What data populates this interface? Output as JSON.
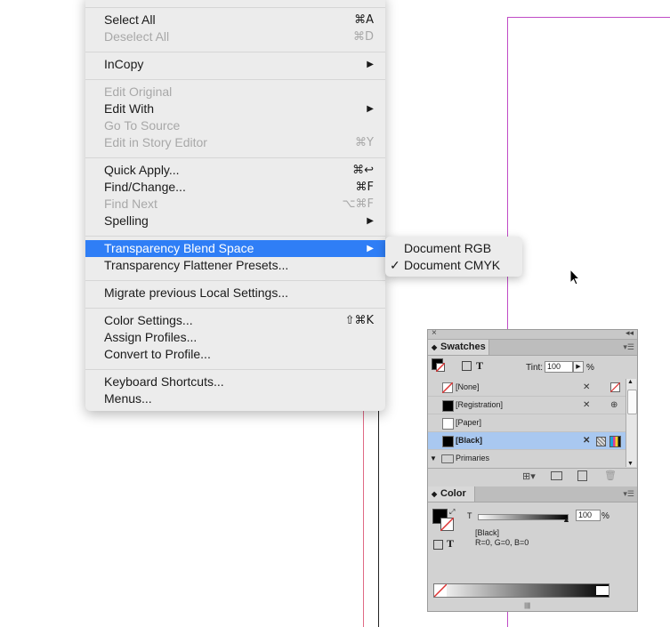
{
  "menu": {
    "items": [
      {
        "label": "Select All",
        "shortcut": "⌘A",
        "disabled": false
      },
      {
        "label": "Deselect All",
        "shortcut": "⌘D",
        "disabled": true
      },
      {
        "label": "InCopy",
        "submenu": true,
        "disabled": false
      },
      {
        "label": "Edit Original",
        "disabled": true
      },
      {
        "label": "Edit With",
        "submenu": true,
        "disabled": false
      },
      {
        "label": "Go To Source",
        "disabled": true
      },
      {
        "label": "Edit in Story Editor",
        "shortcut": "⌘Y",
        "disabled": true
      },
      {
        "label": "Quick Apply...",
        "shortcut": "⌘↩",
        "disabled": false
      },
      {
        "label": "Find/Change...",
        "shortcut": "⌘F",
        "disabled": false
      },
      {
        "label": "Find Next",
        "shortcut": "⌥⌘F",
        "disabled": true
      },
      {
        "label": "Spelling",
        "submenu": true,
        "disabled": false
      },
      {
        "label": "Transparency Blend Space",
        "submenu": true,
        "highlighted": true
      },
      {
        "label": "Transparency Flattener Presets...",
        "disabled": false
      },
      {
        "label": "Migrate previous Local Settings...",
        "disabled": false
      },
      {
        "label": "Color Settings...",
        "shortcut": "⇧⌘K",
        "disabled": false
      },
      {
        "label": "Assign Profiles...",
        "disabled": false
      },
      {
        "label": "Convert to Profile...",
        "disabled": false
      },
      {
        "label": "Keyboard Shortcuts...",
        "disabled": false
      },
      {
        "label": "Menus...",
        "disabled": false
      }
    ],
    "arrow": "▶"
  },
  "submenu": {
    "items": [
      {
        "label": "Document RGB",
        "checked": false
      },
      {
        "label": "Document CMYK",
        "checked": true
      }
    ],
    "check": "✓"
  },
  "swatches": {
    "tab_label": "Swatches",
    "tint_label": "Tint:",
    "tint_value": "100",
    "percent": "%",
    "text_toggle": "T",
    "rows": [
      {
        "name": "[None]",
        "color": "#ffffff",
        "selected": false
      },
      {
        "name": "[Registration]",
        "color": "#000000",
        "selected": false
      },
      {
        "name": "[Paper]",
        "color": "#ffffff",
        "selected": false
      },
      {
        "name": "[Black]",
        "color": "#000000",
        "selected": true
      },
      {
        "name": "Primaries",
        "folder": true
      }
    ]
  },
  "color_panel": {
    "tab_label": "Color",
    "channel_label": "T",
    "value": "100",
    "percent": "%",
    "swatch_name": "[Black]",
    "values_text": "R=0, G=0, B=0",
    "text_toggle": "T"
  },
  "colors": {
    "highlight": "#2f7ef6",
    "guide_magenta": "#c04cc6",
    "selected_row": "#a9c8f0"
  }
}
